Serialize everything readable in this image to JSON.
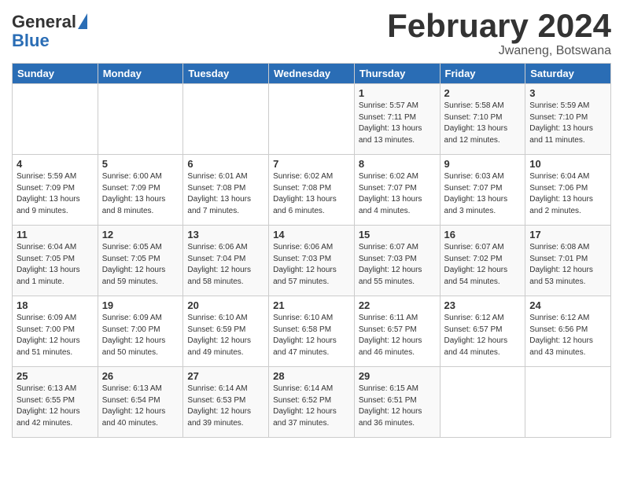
{
  "header": {
    "logo_line1": "General",
    "logo_line2": "Blue",
    "month": "February 2024",
    "location": "Jwaneng, Botswana"
  },
  "days_of_week": [
    "Sunday",
    "Monday",
    "Tuesday",
    "Wednesday",
    "Thursday",
    "Friday",
    "Saturday"
  ],
  "weeks": [
    [
      {
        "day": "",
        "content": ""
      },
      {
        "day": "",
        "content": ""
      },
      {
        "day": "",
        "content": ""
      },
      {
        "day": "",
        "content": ""
      },
      {
        "day": "1",
        "content": "Sunrise: 5:57 AM\nSunset: 7:11 PM\nDaylight: 13 hours and 13 minutes."
      },
      {
        "day": "2",
        "content": "Sunrise: 5:58 AM\nSunset: 7:10 PM\nDaylight: 13 hours and 12 minutes."
      },
      {
        "day": "3",
        "content": "Sunrise: 5:59 AM\nSunset: 7:10 PM\nDaylight: 13 hours and 11 minutes."
      }
    ],
    [
      {
        "day": "4",
        "content": "Sunrise: 5:59 AM\nSunset: 7:09 PM\nDaylight: 13 hours and 9 minutes."
      },
      {
        "day": "5",
        "content": "Sunrise: 6:00 AM\nSunset: 7:09 PM\nDaylight: 13 hours and 8 minutes."
      },
      {
        "day": "6",
        "content": "Sunrise: 6:01 AM\nSunset: 7:08 PM\nDaylight: 13 hours and 7 minutes."
      },
      {
        "day": "7",
        "content": "Sunrise: 6:02 AM\nSunset: 7:08 PM\nDaylight: 13 hours and 6 minutes."
      },
      {
        "day": "8",
        "content": "Sunrise: 6:02 AM\nSunset: 7:07 PM\nDaylight: 13 hours and 4 minutes."
      },
      {
        "day": "9",
        "content": "Sunrise: 6:03 AM\nSunset: 7:07 PM\nDaylight: 13 hours and 3 minutes."
      },
      {
        "day": "10",
        "content": "Sunrise: 6:04 AM\nSunset: 7:06 PM\nDaylight: 13 hours and 2 minutes."
      }
    ],
    [
      {
        "day": "11",
        "content": "Sunrise: 6:04 AM\nSunset: 7:05 PM\nDaylight: 13 hours and 1 minute."
      },
      {
        "day": "12",
        "content": "Sunrise: 6:05 AM\nSunset: 7:05 PM\nDaylight: 12 hours and 59 minutes."
      },
      {
        "day": "13",
        "content": "Sunrise: 6:06 AM\nSunset: 7:04 PM\nDaylight: 12 hours and 58 minutes."
      },
      {
        "day": "14",
        "content": "Sunrise: 6:06 AM\nSunset: 7:03 PM\nDaylight: 12 hours and 57 minutes."
      },
      {
        "day": "15",
        "content": "Sunrise: 6:07 AM\nSunset: 7:03 PM\nDaylight: 12 hours and 55 minutes."
      },
      {
        "day": "16",
        "content": "Sunrise: 6:07 AM\nSunset: 7:02 PM\nDaylight: 12 hours and 54 minutes."
      },
      {
        "day": "17",
        "content": "Sunrise: 6:08 AM\nSunset: 7:01 PM\nDaylight: 12 hours and 53 minutes."
      }
    ],
    [
      {
        "day": "18",
        "content": "Sunrise: 6:09 AM\nSunset: 7:00 PM\nDaylight: 12 hours and 51 minutes."
      },
      {
        "day": "19",
        "content": "Sunrise: 6:09 AM\nSunset: 7:00 PM\nDaylight: 12 hours and 50 minutes."
      },
      {
        "day": "20",
        "content": "Sunrise: 6:10 AM\nSunset: 6:59 PM\nDaylight: 12 hours and 49 minutes."
      },
      {
        "day": "21",
        "content": "Sunrise: 6:10 AM\nSunset: 6:58 PM\nDaylight: 12 hours and 47 minutes."
      },
      {
        "day": "22",
        "content": "Sunrise: 6:11 AM\nSunset: 6:57 PM\nDaylight: 12 hours and 46 minutes."
      },
      {
        "day": "23",
        "content": "Sunrise: 6:12 AM\nSunset: 6:57 PM\nDaylight: 12 hours and 44 minutes."
      },
      {
        "day": "24",
        "content": "Sunrise: 6:12 AM\nSunset: 6:56 PM\nDaylight: 12 hours and 43 minutes."
      }
    ],
    [
      {
        "day": "25",
        "content": "Sunrise: 6:13 AM\nSunset: 6:55 PM\nDaylight: 12 hours and 42 minutes."
      },
      {
        "day": "26",
        "content": "Sunrise: 6:13 AM\nSunset: 6:54 PM\nDaylight: 12 hours and 40 minutes."
      },
      {
        "day": "27",
        "content": "Sunrise: 6:14 AM\nSunset: 6:53 PM\nDaylight: 12 hours and 39 minutes."
      },
      {
        "day": "28",
        "content": "Sunrise: 6:14 AM\nSunset: 6:52 PM\nDaylight: 12 hours and 37 minutes."
      },
      {
        "day": "29",
        "content": "Sunrise: 6:15 AM\nSunset: 6:51 PM\nDaylight: 12 hours and 36 minutes."
      },
      {
        "day": "",
        "content": ""
      },
      {
        "day": "",
        "content": ""
      }
    ]
  ]
}
